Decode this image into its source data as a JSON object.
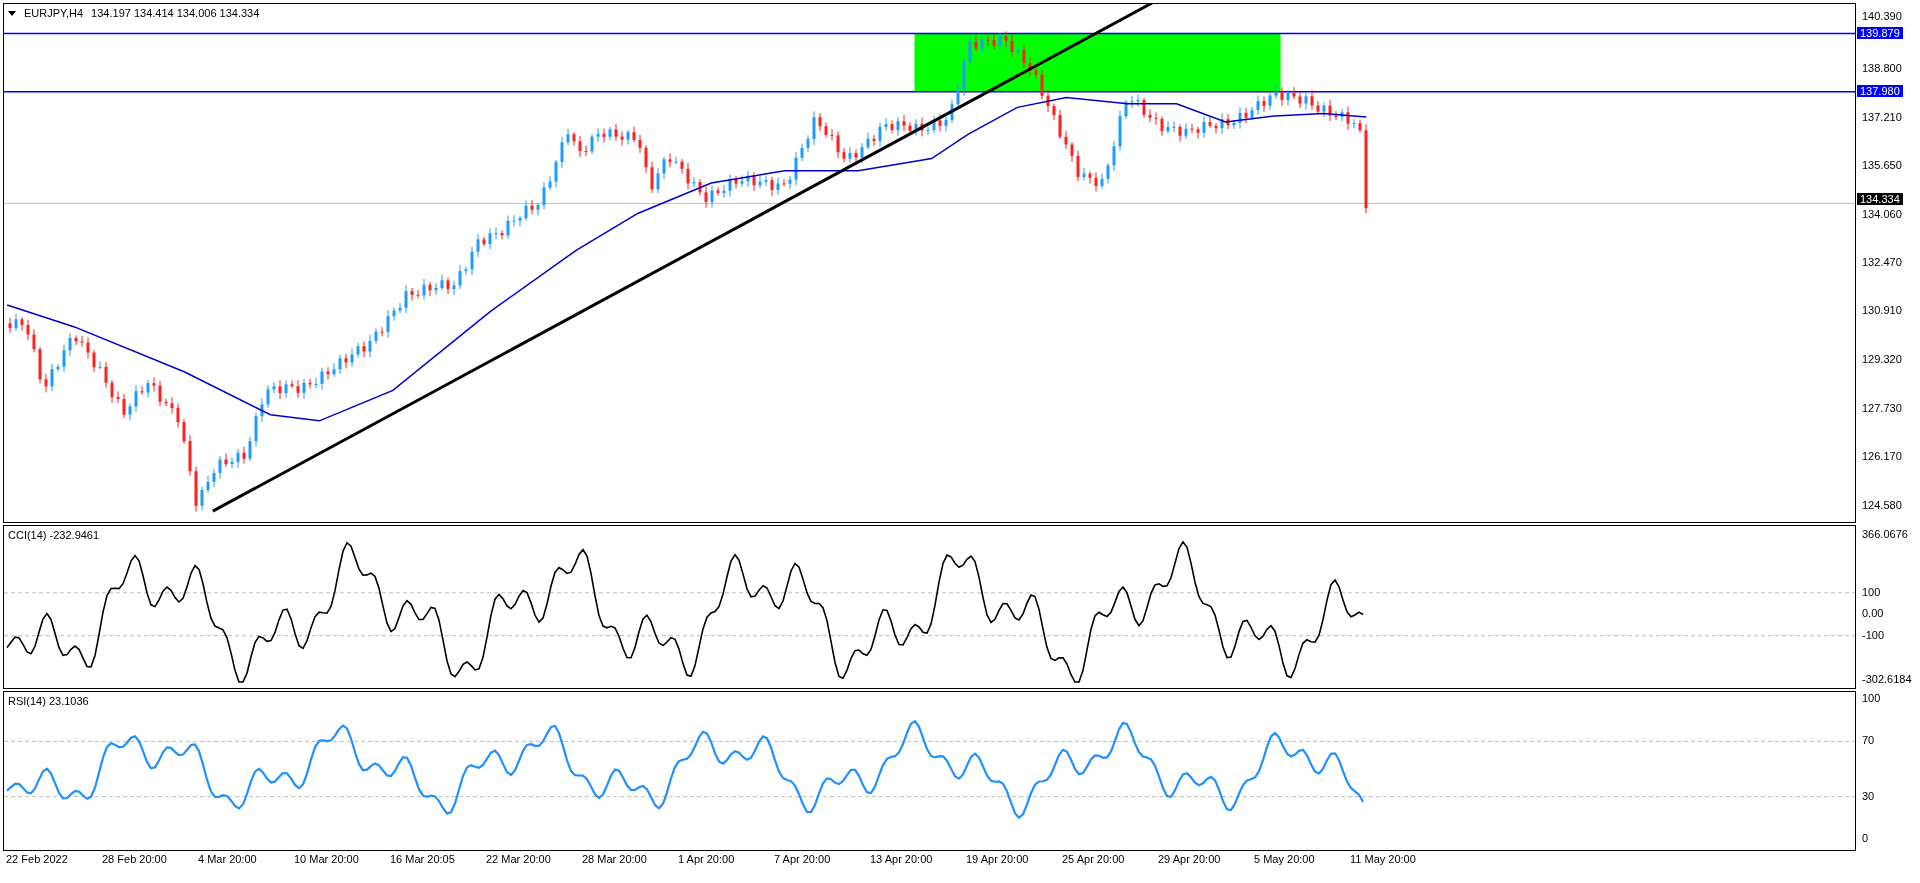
{
  "header": {
    "symbol": "EURJPY,H4",
    "ohlc": "134.197 134.414 134.006 134.334"
  },
  "price_axis": {
    "labels": [
      "140.390",
      "138.800",
      "137.210",
      "135.650",
      "134.060",
      "132.470",
      "130.910",
      "129.320",
      "127.730",
      "126.170",
      "124.580"
    ],
    "tags": [
      {
        "text": "139.879",
        "kind": "level"
      },
      {
        "text": "137.980",
        "kind": "level"
      },
      {
        "text": "134.334",
        "kind": "bid"
      }
    ]
  },
  "cci": {
    "title": "CCI(14) -232.9461",
    "labels": [
      {
        "text": "366.0676",
        "kind": "scale"
      },
      {
        "text": "100",
        "kind": "level"
      },
      {
        "text": "0.00",
        "kind": "scale"
      },
      {
        "text": "-100",
        "kind": "level"
      },
      {
        "text": "-302.6184",
        "kind": "scale"
      }
    ]
  },
  "rsi": {
    "title": "RSI(14) 23.1036",
    "labels": [
      {
        "text": "100",
        "kind": "scale"
      },
      {
        "text": "70",
        "kind": "level"
      },
      {
        "text": "30",
        "kind": "level"
      },
      {
        "text": "0",
        "kind": "scale"
      }
    ]
  },
  "time_axis": [
    "22 Feb 2022",
    "28 Feb 20:00",
    "4 Mar 20:00",
    "10 Mar 20:00",
    "16 Mar 20:05",
    "22 Mar 20:00",
    "28 Mar 20:00",
    "1 Apr 20:00",
    "7 Apr 20:00",
    "13 Apr 20:00",
    "19 Apr 20:00",
    "25 Apr 20:00",
    "29 Apr 20:00",
    "5 May 20:00",
    "11 May 20:00"
  ]
}
